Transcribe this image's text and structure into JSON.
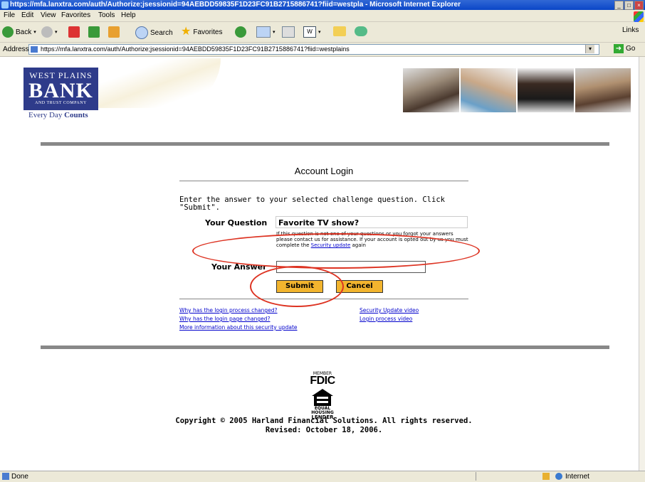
{
  "window": {
    "title": "https://mfa.lanxtra.com/auth/Authorize;jsessionid=94AEBDD59835F1D23FC91B2715886741?fiid=westpla - Microsoft Internet Explorer"
  },
  "menu": [
    "File",
    "Edit",
    "View",
    "Favorites",
    "Tools",
    "Help"
  ],
  "toolbar": {
    "back_label": "Back",
    "search_label": "Search",
    "favorites_label": "Favorites",
    "links_label": "Links"
  },
  "address": {
    "label": "Address",
    "url": "https://mfa.lanxtra.com/auth/Authorize;jsessionid=94AEBDD59835F1D23FC91B2715886741?fiid=westplains",
    "go_label": "Go"
  },
  "bank": {
    "logo_line1": "WEST PLAINS",
    "logo_line2": "BANK",
    "logo_line3": "AND TRUST COMPANY",
    "tagline_prefix": "Every Day ",
    "tagline_bold": "Counts"
  },
  "login": {
    "title": "Account Login",
    "instructions": "Enter the answer to your selected challenge question. Click \"Submit\".",
    "question_label": "Your Question",
    "question_value": "Favorite TV show?",
    "note_text": "If this question is not one of your questions or you forgot your answers please contact us for assistance. If your account is opted out by us you must complete the ",
    "note_link": "Security update",
    "note_suffix": " again",
    "answer_label": "Your Answer",
    "answer_value": "",
    "submit_label": "Submit",
    "cancel_label": "Cancel"
  },
  "help_links": {
    "left": [
      "Why has the login process changed?",
      "Why has the login page changed?",
      "More information about this security update"
    ],
    "right": [
      "Security Update video",
      "Login process video"
    ]
  },
  "footer": {
    "member": "MEMBER",
    "fdic": "FDIC",
    "equal_housing": "EQUAL HOUSING",
    "lender": "LENDER",
    "copyright": "Copyright © 2005 Harland Financial Solutions.  All rights reserved.",
    "revised": "Revised: October 18, 2006."
  },
  "status": {
    "left": "Done",
    "zone": "Internet"
  },
  "colors": {
    "titlebar": "#0a46c8",
    "bank_navy": "#2e3b8a",
    "button": "#f2b42e",
    "annotation": "#d32f2f"
  }
}
